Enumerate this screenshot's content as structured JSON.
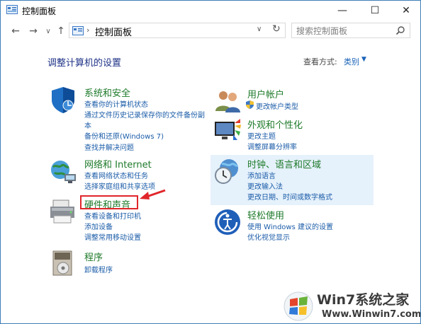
{
  "window": {
    "title": "控制面板",
    "minimize": "—",
    "maximize": "☐",
    "close": "✕"
  },
  "nav": {
    "back": "←",
    "forward": "→",
    "up": "↑",
    "separator": "›",
    "path": "控制面板",
    "dropdown": "∨",
    "refresh": "↻"
  },
  "search": {
    "placeholder": "搜索控制面板"
  },
  "content": {
    "heading": "调整计算机的设置",
    "view_by_label": "查看方式:",
    "view_by_value": "类别",
    "view_by_arrow": "▼"
  },
  "categories": {
    "system": {
      "title": "系统和安全",
      "links": [
        "查看你的计算机状态",
        "通过文件历史记录保存你的文件备份副",
        "本",
        "备份和还原(Windows 7)",
        "查找并解决问题"
      ]
    },
    "network": {
      "title": "网络和 Internet",
      "links": [
        "查看网络状态和任务",
        "选择家庭组和共享选项"
      ]
    },
    "hardware": {
      "title": "硬件和声音",
      "links": [
        "查看设备和打印机",
        "添加设备",
        "调整常用移动设置"
      ]
    },
    "programs": {
      "title": "程序",
      "links": [
        "卸载程序"
      ]
    },
    "accounts": {
      "title": "用户帐户",
      "links": [
        "更改帐户类型"
      ]
    },
    "appearance": {
      "title": "外观和个性化",
      "links": [
        "更改主题",
        "调整屏幕分辨率"
      ]
    },
    "clock": {
      "title": "时钟、语言和区域",
      "links": [
        "添加语言",
        "更改输入法",
        "更改日期、时间或数字格式"
      ]
    },
    "ease": {
      "title": "轻松使用",
      "links": [
        "使用 Windows 建议的设置",
        "优化视觉显示"
      ]
    }
  },
  "watermark": {
    "text": "Win7系统之家",
    "url": "Www.Winwin7.com"
  },
  "colors": {
    "heading": "#1e3287",
    "category_title": "#1e7a2a",
    "link": "#1b5ca8",
    "highlight": "#e0262a",
    "hover_bg": "#e5f1fb"
  }
}
